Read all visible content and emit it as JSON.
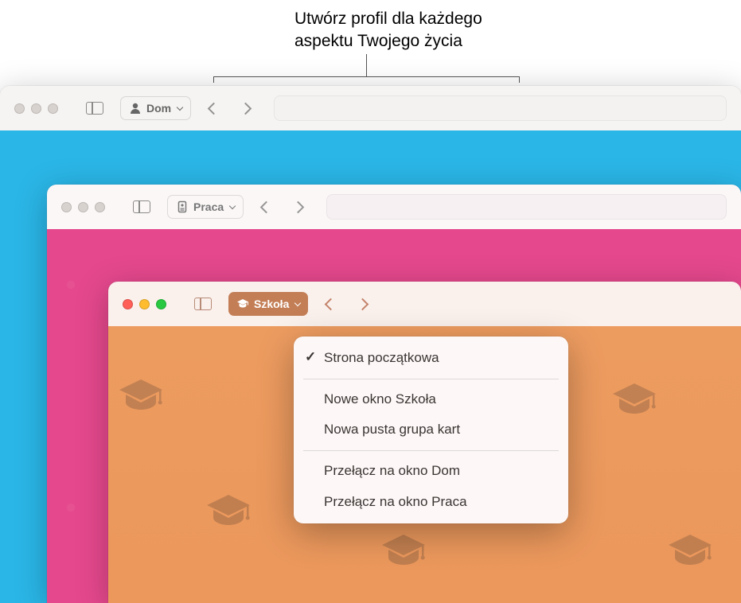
{
  "callout": {
    "line1": "Utwórz profil dla każdego",
    "line2": "aspektu Twojego życia"
  },
  "windows": {
    "w1": {
      "profile_label": "Dom"
    },
    "w2": {
      "profile_label": "Praca"
    },
    "w3": {
      "profile_label": "Szkoła"
    }
  },
  "menu": {
    "items": [
      {
        "label": "Strona początkowa",
        "checked": true
      },
      {
        "separator": true
      },
      {
        "label": "Nowe okno Szkoła"
      },
      {
        "label": "Nowa pusta grupa kart"
      },
      {
        "separator": true
      },
      {
        "label": "Przełącz na okno Dom"
      },
      {
        "label": "Przełącz na okno Praca"
      }
    ]
  }
}
